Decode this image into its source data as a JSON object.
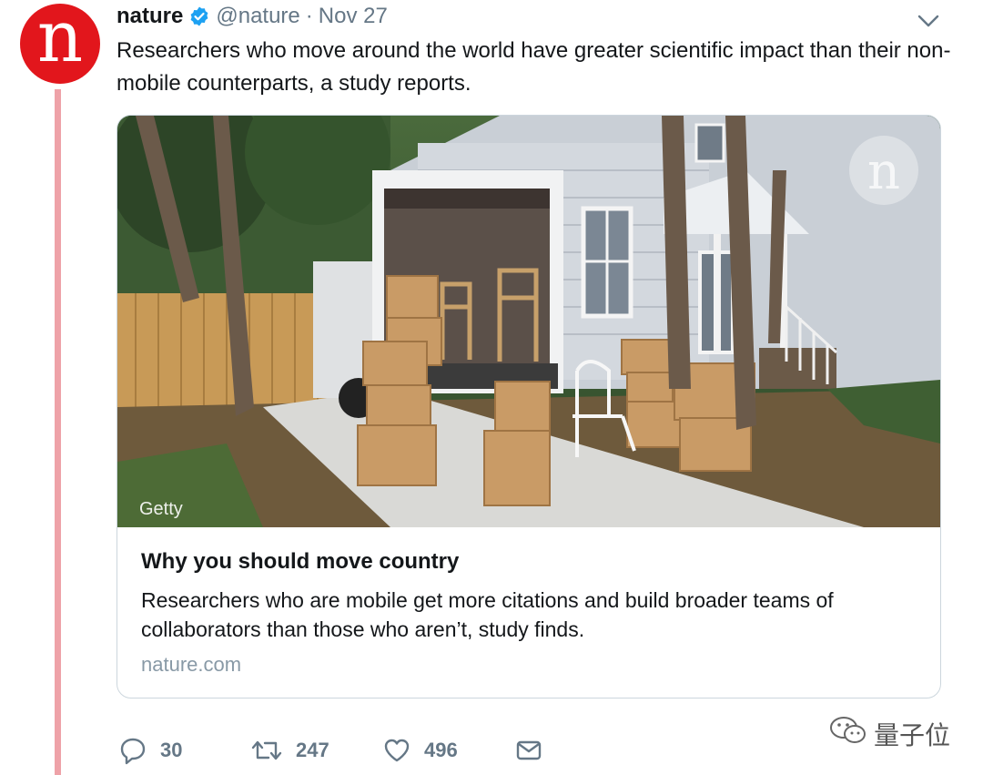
{
  "author": {
    "display_name": "nature",
    "handle": "@nature",
    "separator": "·",
    "date": "Nov 27",
    "avatar_letter": "n"
  },
  "tweet_text": "Researchers who move around the world have greater scientific impact than their non-mobile counterparts, a study reports.",
  "card": {
    "image_credit": "Getty",
    "image_logo_letter": "n",
    "title": "Why you should move country",
    "description": "Researchers who are mobile get more citations and build broader teams of collaborators than those who aren’t, study finds.",
    "domain": "nature.com"
  },
  "actions": {
    "replies": "30",
    "retweets": "247",
    "likes": "496"
  },
  "watermark": "量子位",
  "colors": {
    "brand_red": "#e2161c",
    "verified_blue": "#1da1f2",
    "thread_line": "#eea2a8",
    "muted_text": "#657786"
  },
  "icons": [
    "verified-badge-icon",
    "chevron-down-icon",
    "reply-icon",
    "retweet-icon",
    "like-icon",
    "dm-icon",
    "wechat-icon"
  ]
}
